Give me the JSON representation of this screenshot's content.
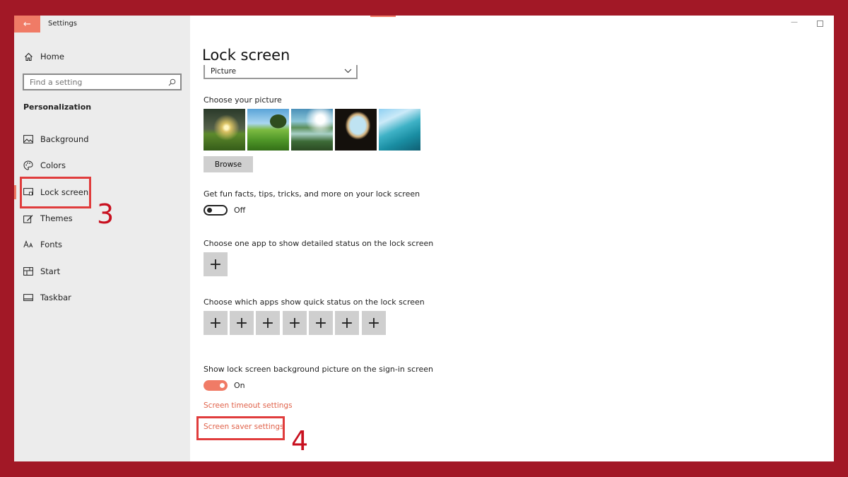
{
  "window": {
    "title": "Settings"
  },
  "sidebar": {
    "home_label": "Home",
    "search_placeholder": "Find a setting",
    "section_title": "Personalization",
    "items": [
      {
        "label": "Background",
        "icon": "image-icon"
      },
      {
        "label": "Colors",
        "icon": "palette-icon"
      },
      {
        "label": "Lock screen",
        "icon": "lock-screen-icon",
        "active": true
      },
      {
        "label": "Themes",
        "icon": "themes-icon"
      },
      {
        "label": "Fonts",
        "icon": "fonts-icon"
      },
      {
        "label": "Start",
        "icon": "start-icon"
      },
      {
        "label": "Taskbar",
        "icon": "taskbar-icon"
      }
    ]
  },
  "annotations": {
    "step3": "3",
    "step4": "4"
  },
  "main": {
    "page_title": "Lock screen",
    "background_dropdown_value": "Picture",
    "choose_picture_label": "Choose your picture",
    "pictures": [
      {
        "name": "sunset-tree-meadow"
      },
      {
        "name": "green-hills-tree"
      },
      {
        "name": "lake-valley"
      },
      {
        "name": "cave-beach"
      },
      {
        "name": "ocean-from-window"
      }
    ],
    "browse_label": "Browse",
    "fun_facts_label": "Get fun facts, tips, tricks, and more on your lock screen",
    "fun_facts_state": "Off",
    "detailed_status_label": "Choose one app to show detailed status on the lock screen",
    "quick_status_label": "Choose which apps show quick status on the lock screen",
    "quick_status_slots": 7,
    "signin_bg_label": "Show lock screen background picture on the sign-in screen",
    "signin_bg_state": "On",
    "timeout_link": "Screen timeout settings",
    "screensaver_link": "Screen saver settings"
  },
  "colors": {
    "accent": "#f07b66",
    "frame": "#a21826",
    "highlight": "#e03c3c",
    "step_number": "#c8101f"
  }
}
